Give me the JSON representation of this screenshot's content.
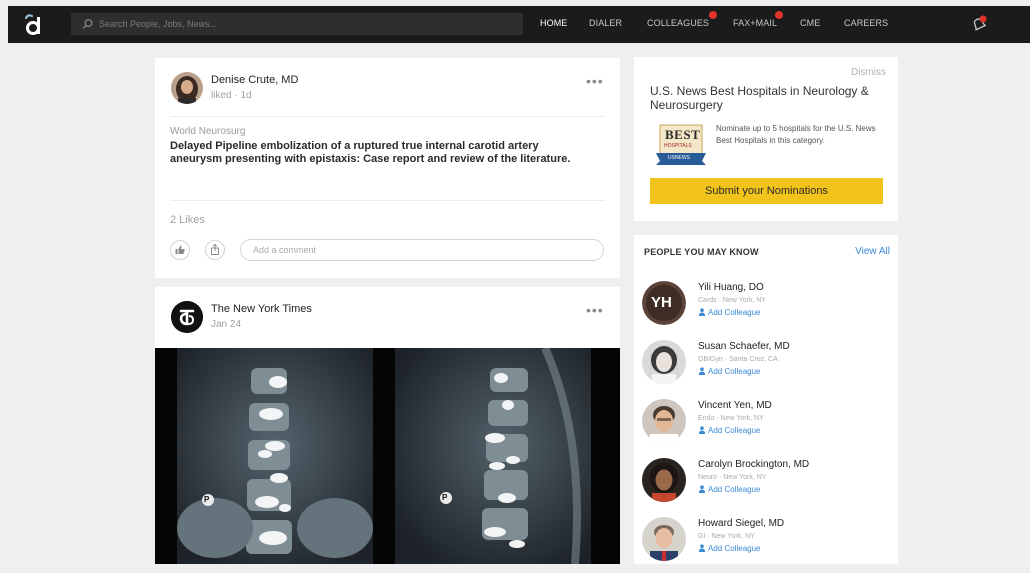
{
  "header": {
    "search_placeholder": "Search People, Jobs, News...",
    "nav": [
      {
        "label": "HOME",
        "active": true
      },
      {
        "label": "DIALER"
      },
      {
        "label": "COLLEAGUES",
        "badge": true
      },
      {
        "label": "FAX+MAIL",
        "badge": true
      },
      {
        "label": "CME"
      },
      {
        "label": "CAREERS"
      }
    ]
  },
  "feed": {
    "post1": {
      "author": "Denise Crute, MD",
      "meta": "liked · 1d",
      "more": "•••",
      "journal": "World Neurosurg",
      "title": "Delayed Pipeline embolization of a ruptured true internal carotid artery aneurysm presenting with epistaxis: Case report and review of the literature.",
      "likes": "2 Likes",
      "comment_placeholder": "Add a comment"
    },
    "post2": {
      "author": "The New York Times",
      "meta": "Jan 24",
      "more": "•••",
      "marker_left": "P",
      "marker_right": "P"
    }
  },
  "sidebar": {
    "ad": {
      "dismiss": "Dismiss",
      "title": "U.S. News Best Hospitals in Neurology & Neurosurgery",
      "badge_text": "BEST",
      "badge_sub": "HOSPITALS",
      "badge_ribbon": "USNEWS",
      "text": "Nominate up to 5 hospitals for the U.S. News Best Hospitals in this category.",
      "cta": "Submit your Nominations"
    },
    "pymk": {
      "title": "PEOPLE YOU MAY KNOW",
      "view_all": "View All",
      "add_label": "Add Colleague",
      "people": [
        {
          "name": "Yili Huang, DO",
          "sub": "Cards · New York, NY",
          "initials": "YH"
        },
        {
          "name": "Susan Schaefer, MD",
          "sub": "OB/Gyn · Santa Cruz, CA"
        },
        {
          "name": "Vincent Yen, MD",
          "sub": "Endo · New York, NY"
        },
        {
          "name": "Carolyn Brockington, MD",
          "sub": "Neuro · New York, NY"
        },
        {
          "name": "Howard Siegel, MD",
          "sub": "GI · New York, NY"
        }
      ]
    }
  },
  "colors": {
    "topbar": "#1b1b1b",
    "accent_link": "#3a8ad6",
    "cta": "#f2c31b",
    "badge": "#e0342a"
  }
}
